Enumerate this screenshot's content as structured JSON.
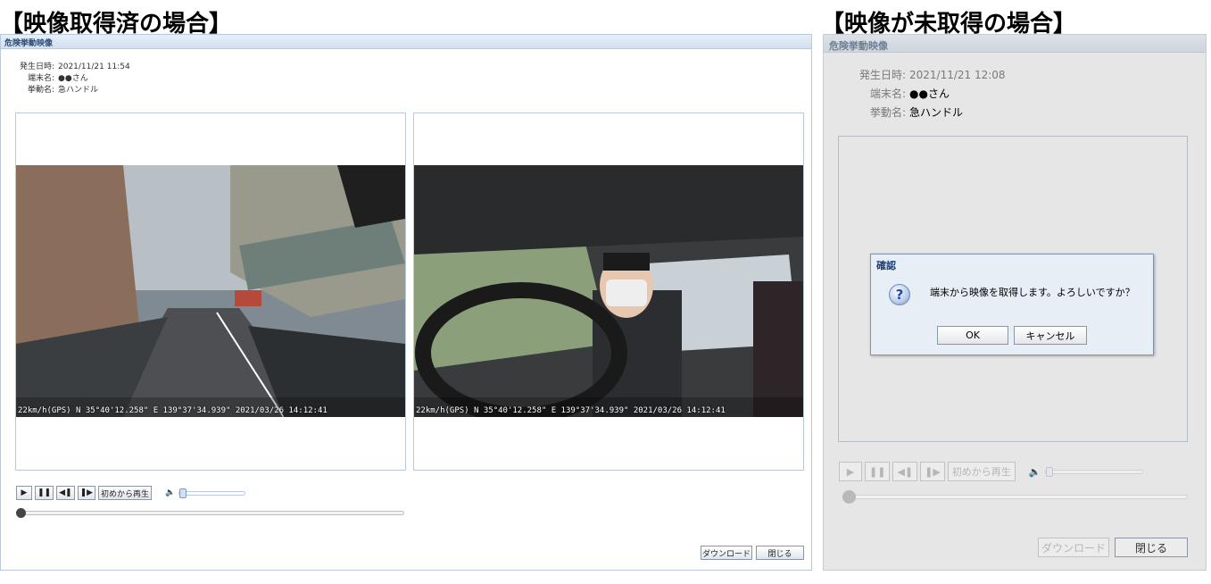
{
  "headings": {
    "acquired": "【映像取得済の場合】",
    "not_acquired": "【映像が未取得の場合】"
  },
  "left_window": {
    "title": "危険挙動映像",
    "info": {
      "date_label": "発生日時:",
      "date_value": "2021/11/21 11:54",
      "device_label": "端末名:",
      "device_value": "●●さん",
      "behavior_label": "挙動名:",
      "behavior_value": "急ハンドル"
    },
    "video_front": {
      "overlay": "22km/h(GPS) N 35°40'12.258\" E 139°37'34.939\"   2021/03/26 14:12:41"
    },
    "video_cabin": {
      "overlay": "22km/h(GPS) N 35°40'12.258\" E 139°37'34.939\"   2021/03/26 14:12:41"
    },
    "controls": {
      "play": "▶",
      "pause": "❚❚",
      "step_back": "◀❚",
      "step_forward": "❚▶",
      "restart": "初めから再生",
      "volume_icon": "🔈"
    },
    "buttons": {
      "download": "ダウンロード",
      "close": "閉じる"
    }
  },
  "right_window": {
    "title": "危険挙動映像",
    "info": {
      "date_label": "発生日時:",
      "date_value": "2021/11/21 12:08",
      "device_label": "端末名:",
      "device_value": "●●さん",
      "behavior_label": "挙動名:",
      "behavior_value": "急ハンドル"
    },
    "dialog": {
      "title": "確認",
      "icon": "?",
      "message": "端末から映像を取得します。よろしいですか？",
      "ok": "OK",
      "cancel": "キャンセル"
    },
    "controls": {
      "play": "▶",
      "pause": "❚❚",
      "step_back": "◀❚",
      "step_forward": "❚▶",
      "restart": "初めから再生",
      "volume_icon": "🔈"
    },
    "buttons": {
      "download": "ダウンロード",
      "close": "閉じる"
    }
  }
}
